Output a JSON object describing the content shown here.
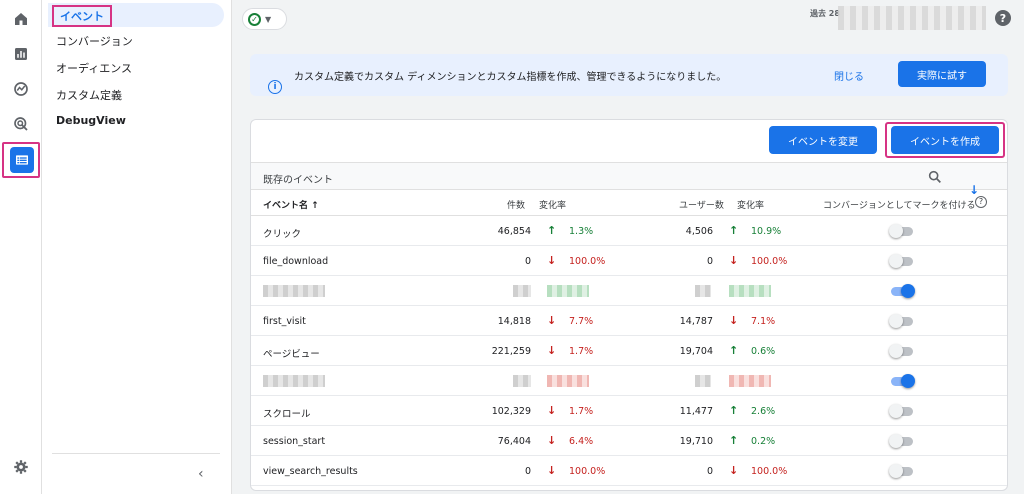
{
  "nav": {
    "items": [
      {
        "label": "イベント"
      },
      {
        "label": "コンバージョン"
      },
      {
        "label": "オーディエンス"
      },
      {
        "label": "カスタム定義"
      },
      {
        "label": "DebugView"
      }
    ],
    "collapse_glyph": "‹"
  },
  "topbar": {
    "date_label": "過去 28",
    "help_glyph": "?"
  },
  "banner": {
    "text": "カスタム定義でカスタム ディメンションとカスタム指標を作成、管理できるようになりました。",
    "dismiss_label": "閉じる",
    "try_label": "実際に試す"
  },
  "card": {
    "modify_label": "イベントを変更",
    "create_label": "イベントを作成",
    "section_title": "既存のイベント",
    "headers": {
      "event_name": "イベント名 ↑",
      "count": "件数",
      "change1": "変化率",
      "users": "ユーザー数",
      "change2": "変化率",
      "conversion": "コンバージョンとしてマークを付ける"
    }
  },
  "rows": [
    {
      "name": "クリック",
      "count": "46,854",
      "c1_dir": "up",
      "c1": "1.3%",
      "users": "4,506",
      "c2_dir": "up",
      "c2": "10.9%",
      "conversion": false,
      "blurred": false
    },
    {
      "name": "file_download",
      "count": "0",
      "c1_dir": "down",
      "c1": "100.0%",
      "users": "0",
      "c2_dir": "down",
      "c2": "100.0%",
      "conversion": false,
      "blurred": false
    },
    {
      "name": "",
      "count": "",
      "c1_dir": "up",
      "c1": "",
      "users": "",
      "c2_dir": "up",
      "c2": "",
      "conversion": true,
      "blurred": true
    },
    {
      "name": "first_visit",
      "count": "14,818",
      "c1_dir": "down",
      "c1": "7.7%",
      "users": "14,787",
      "c2_dir": "down",
      "c2": "7.1%",
      "conversion": false,
      "blurred": false
    },
    {
      "name": "ページビュー",
      "count": "221,259",
      "c1_dir": "down",
      "c1": "1.7%",
      "users": "19,704",
      "c2_dir": "up",
      "c2": "0.6%",
      "conversion": false,
      "blurred": false
    },
    {
      "name": "",
      "count": "",
      "c1_dir": "down",
      "c1": "",
      "users": "",
      "c2_dir": "down",
      "c2": "",
      "conversion": true,
      "blurred": true
    },
    {
      "name": "スクロール",
      "count": "102,329",
      "c1_dir": "down",
      "c1": "1.7%",
      "users": "11,477",
      "c2_dir": "up",
      "c2": "2.6%",
      "conversion": false,
      "blurred": false
    },
    {
      "name": "session_start",
      "count": "76,404",
      "c1_dir": "down",
      "c1": "6.4%",
      "users": "19,710",
      "c2_dir": "up",
      "c2": "0.2%",
      "conversion": false,
      "blurred": false
    },
    {
      "name": "view_search_results",
      "count": "0",
      "c1_dir": "down",
      "c1": "100.0%",
      "users": "0",
      "c2_dir": "down",
      "c2": "100.0%",
      "conversion": false,
      "blurred": false
    }
  ],
  "colors": {
    "accent": "#1a73e8",
    "up": "#188038",
    "down": "#c5221f",
    "highlight": "#d63384"
  },
  "icons": [
    "home-icon",
    "reports-icon",
    "explore-icon",
    "advertising-icon",
    "configure-icon",
    "settings-icon",
    "search-icon",
    "download-icon",
    "info-icon",
    "check-circle-icon"
  ]
}
